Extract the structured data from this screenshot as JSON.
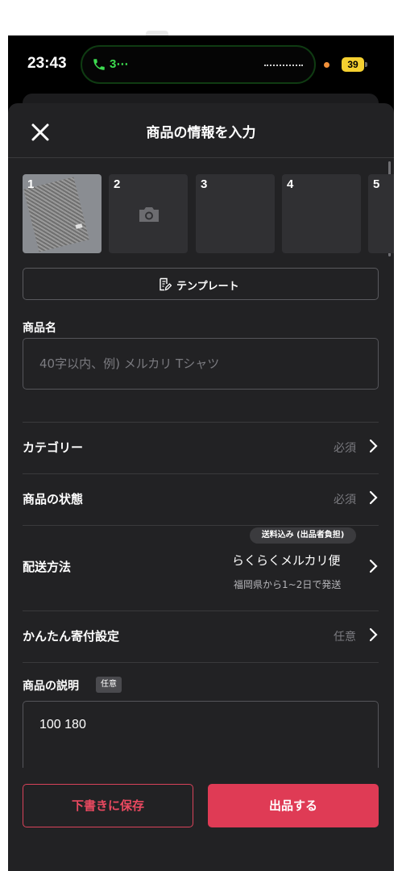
{
  "status_bar": {
    "time": "23:43",
    "call_indicator": "3⋯",
    "battery": "39",
    "icons": [
      "phone-icon",
      "battery-icon"
    ],
    "colors": {
      "call": "#3ddb50",
      "battery": "#f5d030",
      "privacy_dot": "#f2913a"
    }
  },
  "header": {
    "title": "商品の情報を入力",
    "close_icon": "close-icon"
  },
  "photos": {
    "slots": [
      {
        "number": "1",
        "filled": true
      },
      {
        "number": "2",
        "filled": false,
        "icon": "camera-icon"
      },
      {
        "number": "3",
        "filled": false
      },
      {
        "number": "4",
        "filled": false
      },
      {
        "number": "5",
        "filled": false
      }
    ]
  },
  "template_button": {
    "label": "テンプレート",
    "icon": "template-edit-icon"
  },
  "product_name": {
    "label": "商品名",
    "placeholder": "40字以内、例) メルカリ Tシャツ",
    "value": ""
  },
  "category": {
    "label": "カテゴリー",
    "value": "必須"
  },
  "condition": {
    "label": "商品の状態",
    "value": "必須"
  },
  "shipping": {
    "label": "配送方法",
    "badge": "送料込み (出品者負担)",
    "value": "らくらくメルカリ便",
    "sub": "福岡県から1~2日で発送"
  },
  "donation": {
    "label": "かんたん寄付設定",
    "value": "任意"
  },
  "description": {
    "label": "商品の説明",
    "tag": "任意",
    "value": "100  180"
  },
  "actions": {
    "draft_label": "下書きに保存",
    "list_label": "出品する",
    "colors": {
      "primary": "#df3b55",
      "outline": "#d9435a"
    }
  },
  "theme": {
    "background": "#222224",
    "divider": "#3a3a3c",
    "muted_text": "#7b7b80"
  }
}
